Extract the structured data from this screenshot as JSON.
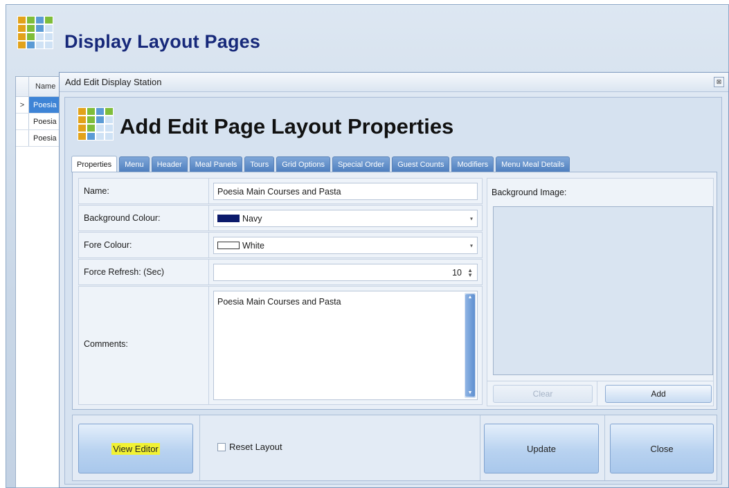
{
  "background_window": {
    "title": "Display Layout Pages",
    "grid": {
      "header": "Name",
      "rows": [
        {
          "indicator": ">",
          "name": "Poesia",
          "selected": true
        },
        {
          "indicator": "",
          "name": "Poesia",
          "selected": false
        },
        {
          "indicator": "",
          "name": "Poesia",
          "selected": false
        }
      ]
    }
  },
  "dialog": {
    "title": "Add Edit Display Station",
    "close_glyph": "⊠",
    "heading": "Add Edit Page Layout Properties",
    "tabs": [
      "Properties",
      "Menu",
      "Header",
      "Meal Panels",
      "Tours",
      "Grid Options",
      "Special Order",
      "Guest Counts",
      "Modifiers",
      "Menu Meal Details"
    ],
    "active_tab": "Properties",
    "form": {
      "name_label": "Name:",
      "name_value": "Poesia Main Courses and Pasta",
      "bg_colour_label": "Background Colour:",
      "bg_colour_value": "Navy",
      "bg_colour_swatch": "#0b1a6b",
      "fore_colour_label": "Fore Colour:",
      "fore_colour_value": "White",
      "fore_colour_swatch": "#ffffff",
      "refresh_label": "Force Refresh: (Sec)",
      "refresh_value": "10",
      "comments_label": "Comments:",
      "comments_value": "Poesia Main Courses and Pasta"
    },
    "background_image": {
      "label": "Background Image:",
      "clear_button": "Clear",
      "add_button": "Add"
    },
    "footer": {
      "view_editor": "View Editor",
      "reset_layout": "Reset Layout",
      "update": "Update",
      "close": "Close"
    }
  },
  "colors": {
    "title_blue": "#17297a",
    "tab_blue": "#5e8ccc",
    "highlight": "#f2f233"
  }
}
